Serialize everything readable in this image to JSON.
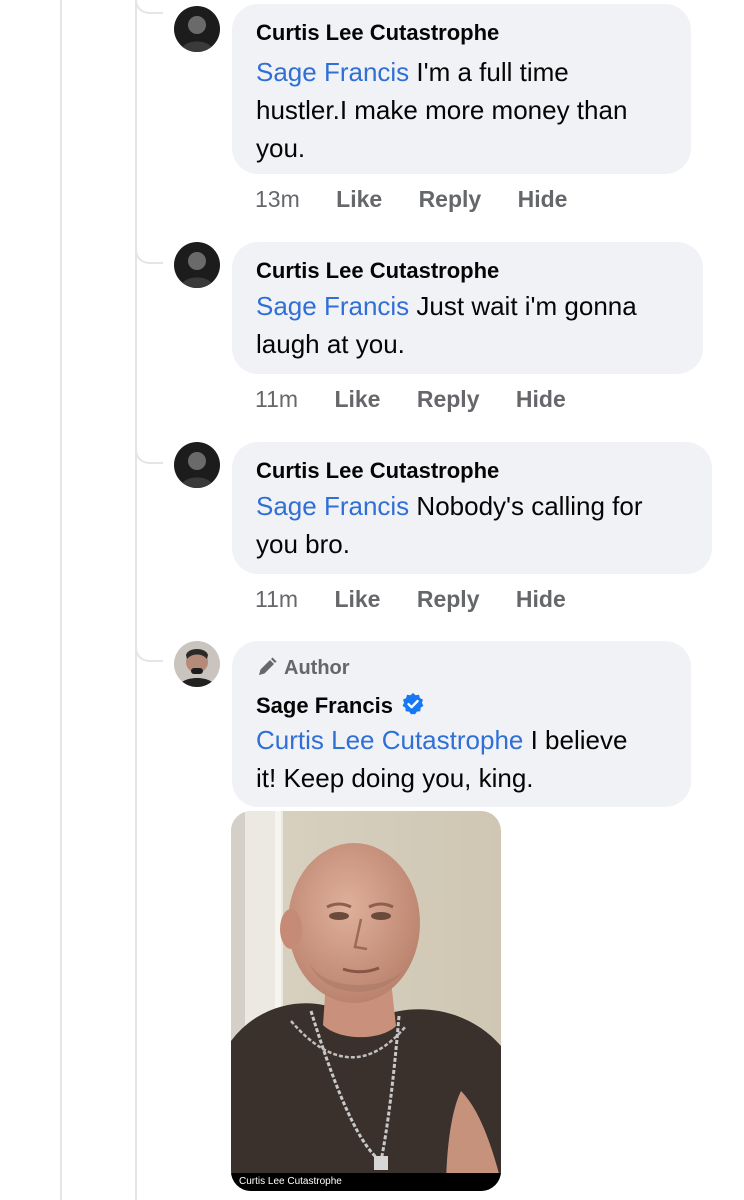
{
  "comments": [
    {
      "author": "Curtis Lee Cutastrophe",
      "mention": "Sage Francis",
      "text_lines": [
        " I'm a full time",
        "hustler.I make more money than",
        "you."
      ],
      "time": "13m",
      "actions": [
        "Like",
        "Reply",
        "Hide"
      ]
    },
    {
      "author": "Curtis Lee Cutastrophe",
      "mention": "Sage Francis",
      "text_lines": [
        " Just wait i'm gonna",
        "laugh at you."
      ],
      "time": "11m",
      "actions": [
        "Like",
        "Reply",
        "Hide"
      ]
    },
    {
      "author": "Curtis Lee Cutastrophe",
      "mention": "Sage Francis",
      "text_lines": [
        " Nobody's calling for",
        "you bro."
      ],
      "time": "11m",
      "actions": [
        "Like",
        "Reply",
        "Hide"
      ]
    },
    {
      "badge": "Author",
      "author": "Sage Francis",
      "verified": true,
      "mention": "Curtis Lee Cutastrophe",
      "text_lines": [
        " I believe",
        "it! Keep doing you, king."
      ],
      "attachment_caption": "Curtis Lee Cutastrophe"
    }
  ],
  "colors": {
    "bubble": "#f0f2f5",
    "mention": "#2f6fd6",
    "meta": "#65676b",
    "verified": "#1877f2"
  },
  "icons": [
    "avatar-icon",
    "pencil-icon",
    "verified-badge-icon"
  ]
}
